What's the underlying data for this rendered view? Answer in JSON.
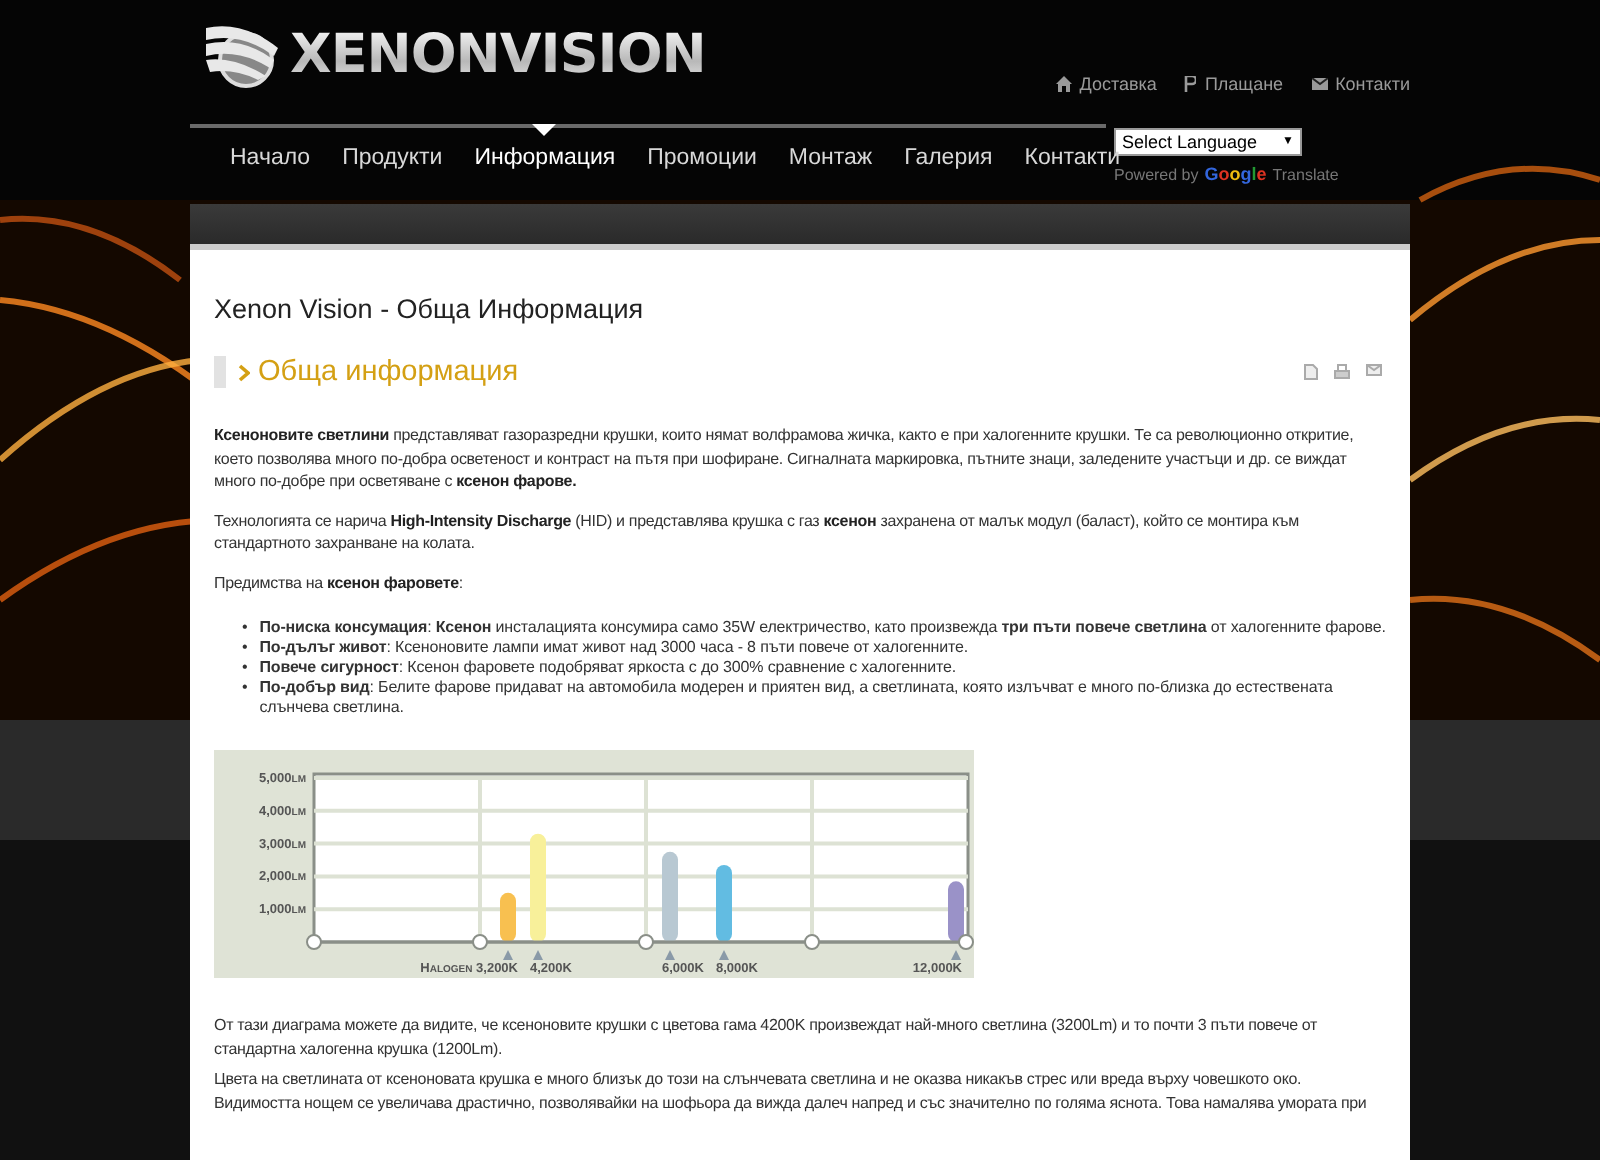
{
  "header": {
    "logo_text": "XENONVISION",
    "top_links": [
      {
        "kind": "home",
        "label": "Доставка"
      },
      {
        "kind": "ruble",
        "label": "Плащане"
      },
      {
        "kind": "mail",
        "label": "Контакти"
      }
    ],
    "language_select": {
      "value": "Select Language",
      "caret": "▼"
    },
    "powered_by": {
      "prefix": "Powered by",
      "brand": "Google",
      "suffix": "Translate"
    }
  },
  "nav": [
    {
      "label": "Начало",
      "selected": false
    },
    {
      "label": "Продукти",
      "selected": false
    },
    {
      "label": "Информация",
      "selected": true
    },
    {
      "label": "Промоции",
      "selected": false
    },
    {
      "label": "Монтаж",
      "selected": false
    },
    {
      "label": "Галерия",
      "selected": false
    },
    {
      "label": "Контакти",
      "selected": false
    }
  ],
  "page_title": "Xenon Vision - Обща Информация",
  "article": {
    "heading": "Обща информация",
    "tools": [
      {
        "kind": "pdf"
      },
      {
        "kind": "print"
      },
      {
        "kind": "email"
      }
    ],
    "intro": [
      "**Ксеноновите светлини** представляват газоразредни крушки, които нямат волфрамова жичка, както е при халогенните крушки. Те са революционно откритие, което позволява много по-добра осветеност и контраст на пътя при шофиране. Сигналната маркировка, пътните знаци, заледените участъци и др. се виждат много по-добре при осветяване с **ксенон фарове.**",
      "Технологията се нарича **High-Intensity Discharge** (HID) и представлява крушка с газ **ксенон** захранена от малък модул (баласт), който се монтира към стандартното захранване на колата.",
      "Предимства на **ксенон фаровете**:"
    ],
    "bullet_marker": "•",
    "bullets": [
      "**По-ниска консумация**: **Ксенон** инсталацията консумира само 35W електричество, като произвежда **три пъти повече светлина** от халогенните фарове.",
      "**По-дълъг живот**: Ксеноновите лампи имат живот над 3000 часа - 8 пъти повече от халогенните.",
      "**Повече сигурност**: Ксенон фаровете подобряват яркоста с до 300% сравнение с халогенните.",
      "**По-добър вид**: Белите фарове придават на автомобила модерен и приятен вид, а светлината, която излъчват е много по-близка до естествената слънчева светлина."
    ],
    "chart_data": {
      "type": "bar",
      "grid": true,
      "categories": [
        "Halogen 3,200K",
        "4,200K",
        "6,000K",
        "8,000K",
        "12,000K"
      ],
      "series": [
        {
          "color": "#f8c050",
          "values": [
            1500,
            null,
            null,
            null,
            null
          ]
        },
        {
          "color": "#f8f09a",
          "values": [
            null,
            3300,
            null,
            null,
            null
          ]
        },
        {
          "color": "#b8c8d2",
          "values": [
            null,
            null,
            2750,
            null,
            null
          ]
        },
        {
          "color": "#62bce2",
          "values": [
            null,
            null,
            null,
            2350,
            null
          ]
        },
        {
          "color": "#9a92c8",
          "values": [
            null,
            null,
            null,
            null,
            1850
          ]
        }
      ],
      "ylim": [
        0,
        5000
      ],
      "yticks": [
        {
          "value": 1000,
          "label": "1,000lm"
        },
        {
          "value": 2000,
          "label": "2,000lm"
        },
        {
          "value": 3000,
          "label": "3,000lm"
        },
        {
          "value": 4000,
          "label": "4,000lm"
        },
        {
          "value": 5000,
          "label": "5,000lm"
        }
      ]
    },
    "outro": [
      "От тази диаграма можете да видите, че ксеноновите крушки с цветова гама 4200K произвеждат най-много светлина (3200Lm) и то почти 3 пъти повече от стандартна халогенна крушка (1200Lm).",
      "Цвета на светлината от ксеноновата крушка е много близък до този на слънчевата светлина и не оказва никакъв стрес или вреда върху човешкото око. Видимостта нощем се увеличава драстично, позволявайки на шофьора да вижда далеч напред и със значително по голяма яснота. Това намалява умората при"
    ]
  }
}
